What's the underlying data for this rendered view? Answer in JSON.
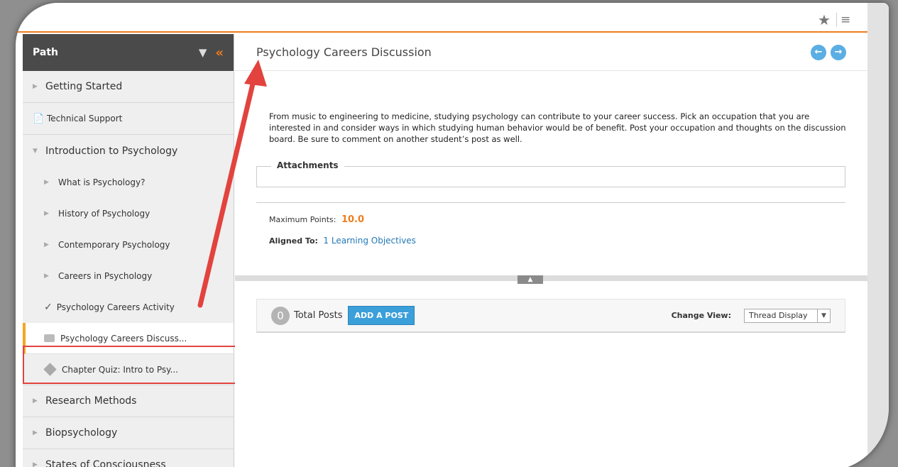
{
  "topbar": {
    "star_icon": "star-icon",
    "menu_icon": "list-menu-icon"
  },
  "sidebar": {
    "title": "Path",
    "items": [
      {
        "label": "Getting Started",
        "type": "section"
      },
      {
        "label": "Technical Support",
        "type": "doc"
      },
      {
        "label": "Introduction to Psychology",
        "type": "section-open"
      },
      {
        "label": "What is Psychology?",
        "type": "sub"
      },
      {
        "label": "History of Psychology",
        "type": "sub"
      },
      {
        "label": "Contemporary Psychology",
        "type": "sub"
      },
      {
        "label": "Careers in Psychology",
        "type": "sub"
      },
      {
        "label": "Psychology Careers Activity",
        "type": "activity"
      },
      {
        "label": "Psychology Careers Discuss...",
        "type": "discussion-active"
      },
      {
        "label": "Chapter Quiz: Intro to Psy...",
        "type": "quiz"
      },
      {
        "label": "Research Methods",
        "type": "section"
      },
      {
        "label": "Biopsychology",
        "type": "section"
      },
      {
        "label": "States of Consciousness",
        "type": "section"
      }
    ]
  },
  "main": {
    "title": "Psychology Careers Discussion",
    "description": "From music to engineering to medicine, studying psychology can contribute to your career success. Pick an occupation that you are interested in and consider ways in which studying human behavior would be of benefit. Post your occupation and thoughts on the discussion board. Be sure to comment on another student’s post as well.",
    "attachments_label": "Attachments",
    "max_points_label": "Maximum Points:",
    "max_points_value": "10.0",
    "aligned_label": "Aligned To:",
    "aligned_link": "1 Learning Objectives"
  },
  "posts": {
    "count": "0",
    "total_label": "Total Posts",
    "add_button": "ADD A POST",
    "change_view_label": "Change View:",
    "view_selected": "Thread Display"
  },
  "colors": {
    "accent": "#f07c1e",
    "link": "#2479b5",
    "button": "#3b9fd9",
    "annotation": "#e2433e"
  }
}
